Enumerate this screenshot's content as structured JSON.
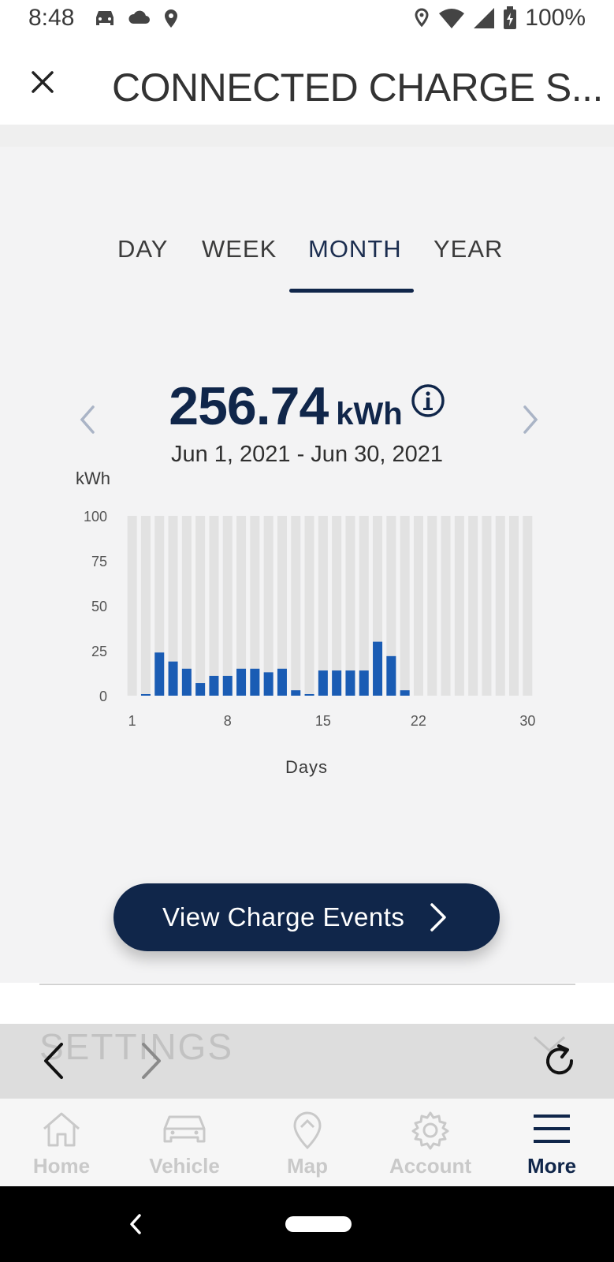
{
  "status_bar": {
    "time": "8:48",
    "battery": "100%"
  },
  "header": {
    "title": "CONNECTED CHARGE S..."
  },
  "tabs": [
    {
      "label": "DAY",
      "active": false
    },
    {
      "label": "WEEK",
      "active": false
    },
    {
      "label": "MONTH",
      "active": true
    },
    {
      "label": "YEAR",
      "active": false
    }
  ],
  "summary": {
    "value": "256.74",
    "unit": "kWh",
    "date_range": "Jun 1, 2021 - Jun 30, 2021"
  },
  "chart_data": {
    "type": "bar",
    "ylabel": "kWh",
    "xlabel": "Days",
    "ylim": [
      0,
      100
    ],
    "yticks": [
      100,
      75,
      50,
      25,
      0
    ],
    "xticks": [
      1,
      8,
      15,
      22,
      30
    ],
    "categories": [
      1,
      2,
      3,
      4,
      5,
      6,
      7,
      8,
      9,
      10,
      11,
      12,
      13,
      14,
      15,
      16,
      17,
      18,
      19,
      20,
      21,
      22,
      23,
      24,
      25,
      26,
      27,
      28,
      29,
      30
    ],
    "values": [
      0,
      0.5,
      24,
      19,
      15,
      7,
      11,
      11,
      15,
      15,
      13,
      15,
      3,
      0.5,
      14,
      14,
      14,
      14,
      30,
      22,
      3,
      0,
      0,
      0,
      0,
      0,
      0,
      0,
      0,
      0
    ],
    "background_max": 100,
    "colors": {
      "bar": "#1a5cb4",
      "track": "#e2e2e2"
    }
  },
  "cta": {
    "label": "View Charge Events"
  },
  "overlay": {
    "settings_text": "SETTINGS"
  },
  "bottom_nav": [
    {
      "label": "Home",
      "icon": "home-icon",
      "active": false
    },
    {
      "label": "Vehicle",
      "icon": "vehicle-icon",
      "active": false
    },
    {
      "label": "Map",
      "icon": "map-pin-icon",
      "active": false
    },
    {
      "label": "Account",
      "icon": "gear-icon",
      "active": false
    },
    {
      "label": "More",
      "icon": "menu-icon",
      "active": true
    }
  ],
  "colors": {
    "navy": "#10264a",
    "bar_blue": "#1a5cb4",
    "inactive_nav": "#c9c9c9"
  }
}
